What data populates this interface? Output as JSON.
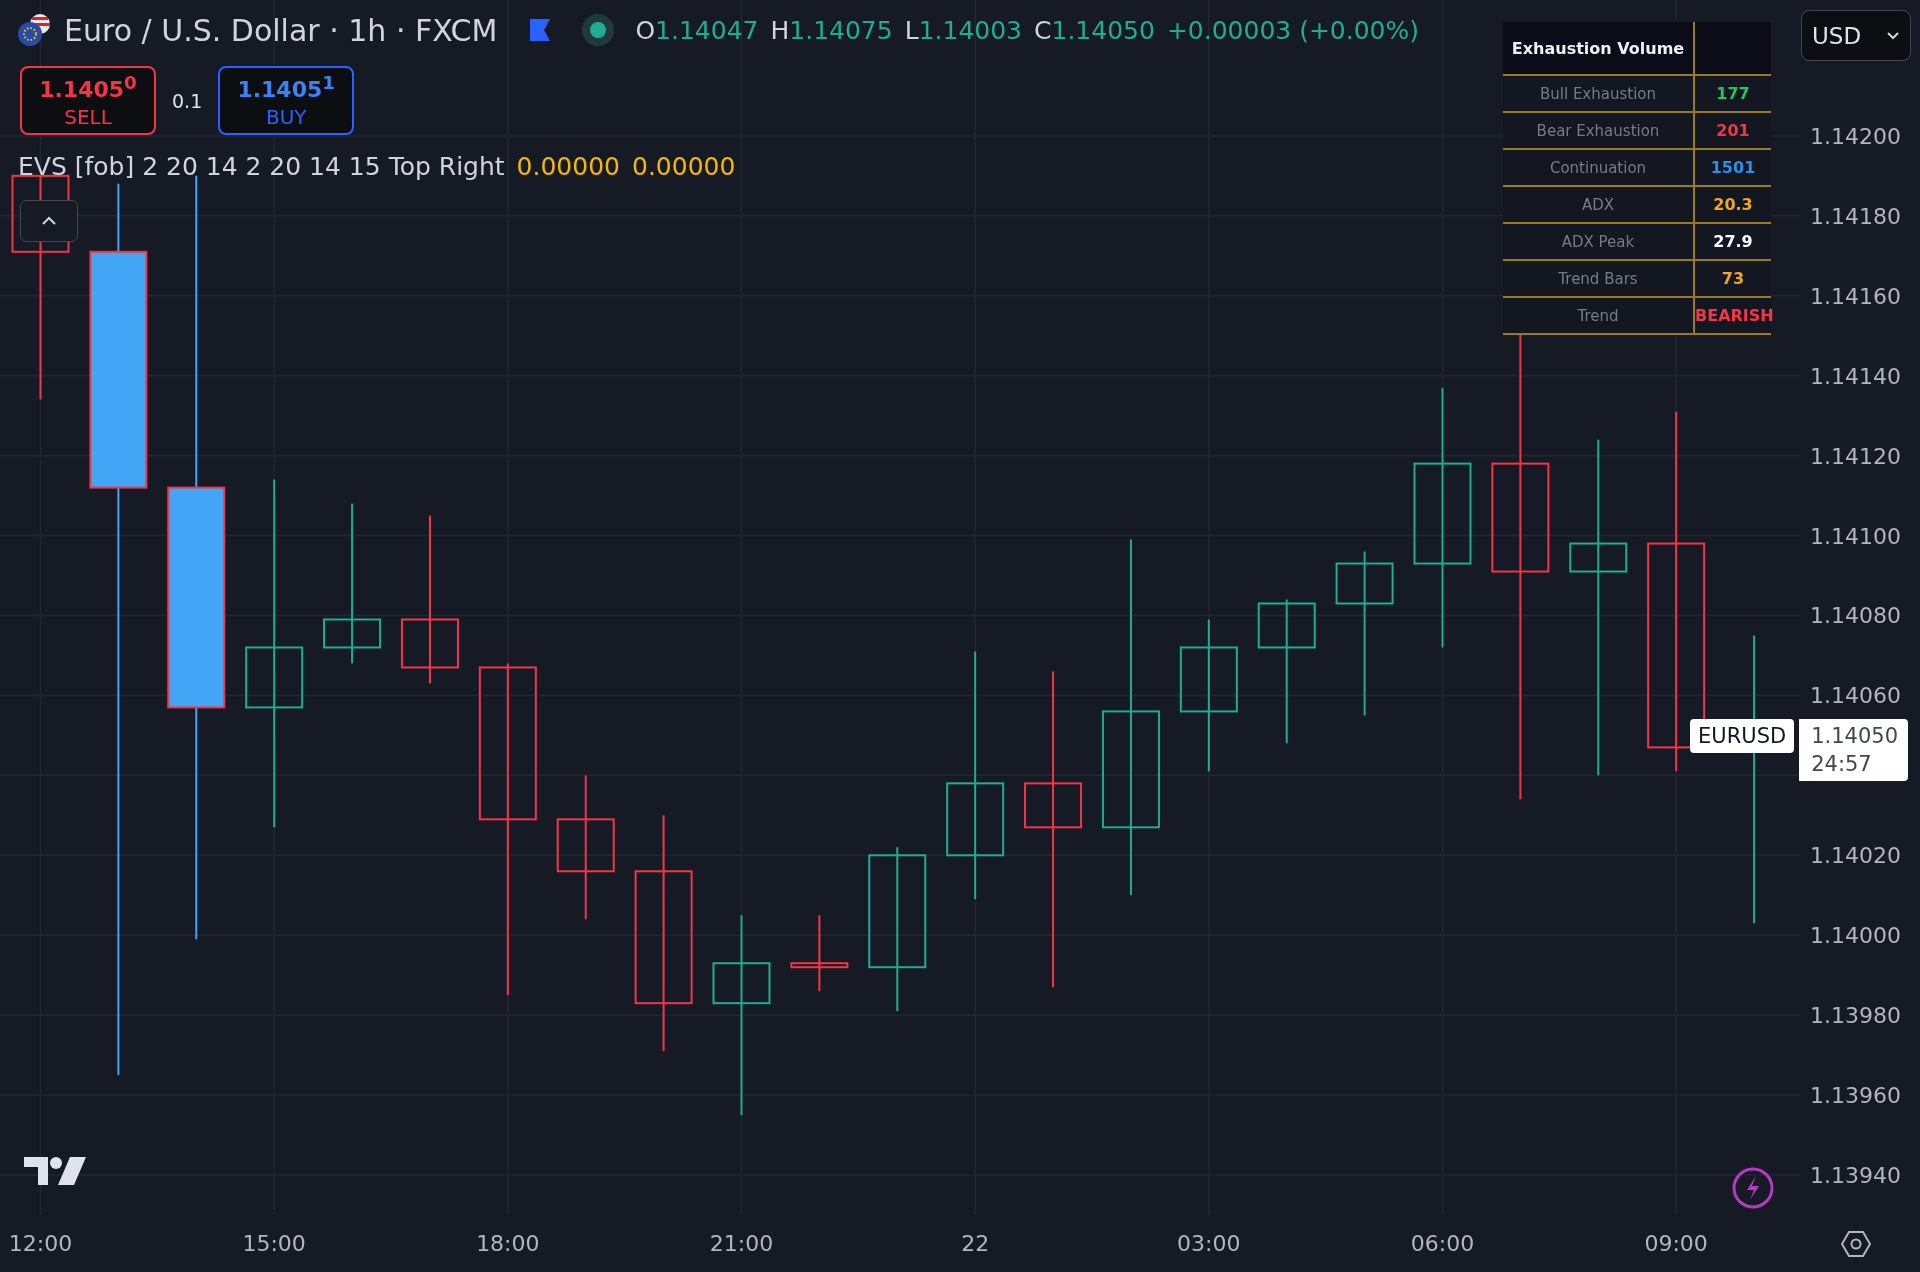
{
  "header": {
    "symbol": "Euro / U.S. Dollar · 1h · FXCM",
    "ohlc": [
      {
        "label": "O",
        "value": "1.14047"
      },
      {
        "label": "H",
        "value": "1.14075"
      },
      {
        "label": "L",
        "value": "1.14003"
      },
      {
        "label": "C",
        "value": "1.14050"
      }
    ],
    "change": "+0.00003 (+0.00%)"
  },
  "trade": {
    "sell_price": "1.1405$^{0}$",
    "sell_label": "SELL",
    "quantity": "0.1",
    "buy_price": "1.1405$^{1}$",
    "buy_label": "BUY"
  },
  "indicator": {
    "name": "EVS [fob] 2 20 14 2 20 14 15 Top Right",
    "values": [
      "0.00000",
      "0.00000"
    ]
  },
  "table": {
    "title": "Exhaustion Volume",
    "rows": [
      {
        "label": "Bull Exhaustion",
        "value": "177",
        "color": "#22c55e"
      },
      {
        "label": "Bear Exhaustion",
        "value": "201",
        "color": "#f23645"
      },
      {
        "label": "Continuation",
        "value": "1501",
        "color": "#2f8fe8"
      },
      {
        "label": "ADX",
        "value": "20.3",
        "color": "#f5a623"
      },
      {
        "label": "ADX Peak",
        "value": "27.9",
        "color": "#ffffff"
      },
      {
        "label": "Trend Bars",
        "value": "73",
        "color": "#f5a623"
      },
      {
        "label": "Trend",
        "value": "BEARISH",
        "color": "#f23645"
      }
    ]
  },
  "currency": "USD",
  "price_label": {
    "symbol": "EURUSD",
    "price": "1.14050",
    "countdown": "24:57"
  },
  "chart": {
    "price_axis": [
      "1.14200",
      "1.14180",
      "1.14160",
      "1.14140",
      "1.14120",
      "1.14100",
      "1.14080",
      "1.14060",
      "1.14020",
      "1.14000",
      "1.13980",
      "1.13960",
      "1.13940"
    ],
    "time_axis": [
      "12:00",
      "15:00",
      "18:00",
      "21:00",
      "22",
      "03:00",
      "06:00",
      "09:00"
    ]
  }
}
